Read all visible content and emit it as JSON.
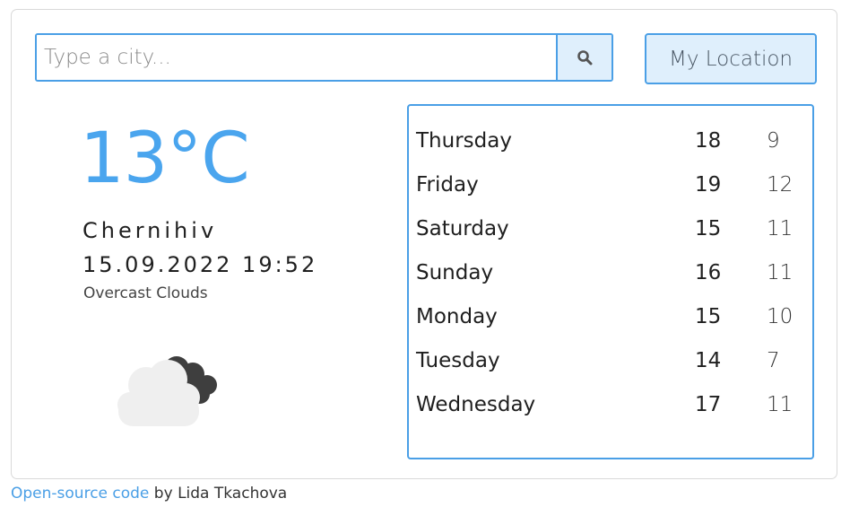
{
  "search": {
    "placeholder": "Type a city...",
    "button_icon": "search-icon"
  },
  "location_button": {
    "label": "My Location"
  },
  "current": {
    "temperature": "13°C",
    "city": "Chernihiv",
    "datetime": "15.09.2022 19:52",
    "description": "Overcast Clouds",
    "icon": "overcast-clouds-icon"
  },
  "forecast": [
    {
      "day": "Thursday",
      "max": "18",
      "min": "9"
    },
    {
      "day": "Friday",
      "max": "19",
      "min": "12"
    },
    {
      "day": "Saturday",
      "max": "15",
      "min": "11"
    },
    {
      "day": "Sunday",
      "max": "16",
      "min": "11"
    },
    {
      "day": "Monday",
      "max": "15",
      "min": "10"
    },
    {
      "day": "Tuesday",
      "max": "14",
      "min": "7"
    },
    {
      "day": "Wednesday",
      "max": "17",
      "min": "11"
    }
  ],
  "footer": {
    "link_text": "Open-source code",
    "suffix": " by Lida Tkachova"
  },
  "colors": {
    "accent": "#4a9fe6",
    "temperature": "#4aa5ee",
    "button_bg": "#dfeffc"
  }
}
